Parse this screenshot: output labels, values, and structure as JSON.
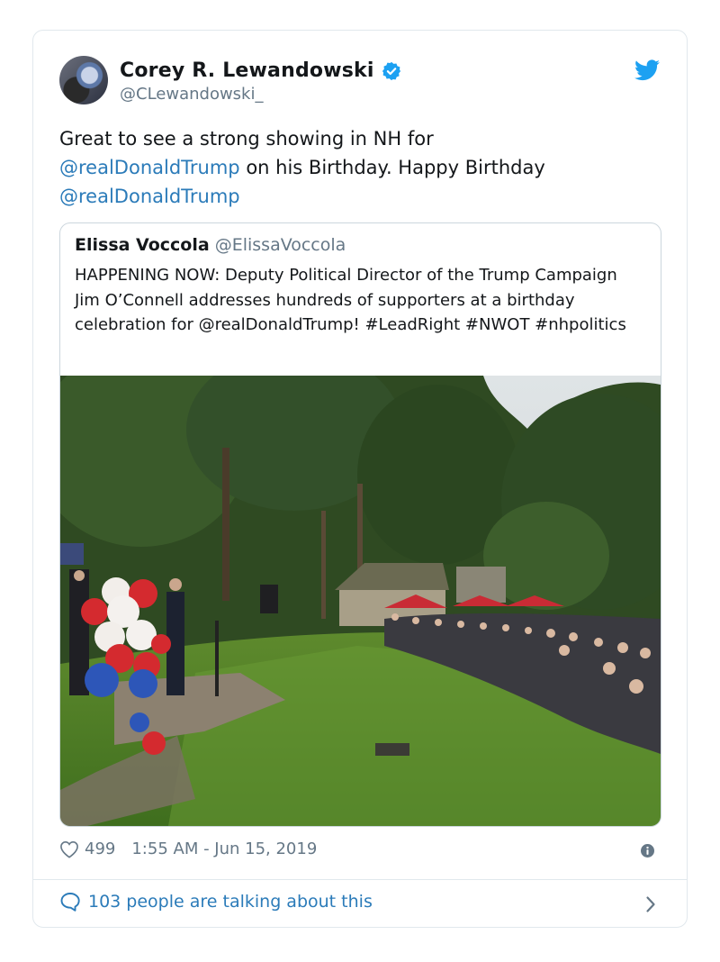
{
  "author": {
    "name": "Corey R. Lewandowski",
    "handle": "@CLewandowski_"
  },
  "tweet": {
    "line1": "Great to see a strong showing in NH for",
    "mention1": "@realDonaldTrump",
    "mid": " on his Birthday.  Happy Birthday",
    "mention2": "@realDonaldTrump"
  },
  "quoted": {
    "name": "Elissa Voccola",
    "handle": "@ElissaVoccola",
    "text": "HAPPENING NOW: Deputy Political Director of the Trump Campaign Jim O’Connell addresses hundreds of supporters at a birthday celebration for @realDonaldTrump! #LeadRight #NWOT #nhpolitics"
  },
  "meta": {
    "likes": "499",
    "timestamp": "1:55 AM - Jun 15, 2019"
  },
  "footer": {
    "talking": "103 people are talking about this"
  },
  "icons": {
    "verified": "verified-badge-icon",
    "twitter": "twitter-bird-icon",
    "like": "heart-icon",
    "info": "info-icon",
    "reply": "speech-bubble-icon",
    "more": "chevron-right-icon"
  },
  "colors": {
    "link": "#2b7bb9",
    "twitter_blue": "#1da1f2",
    "muted": "#657786",
    "border": "#e1e8ed"
  }
}
